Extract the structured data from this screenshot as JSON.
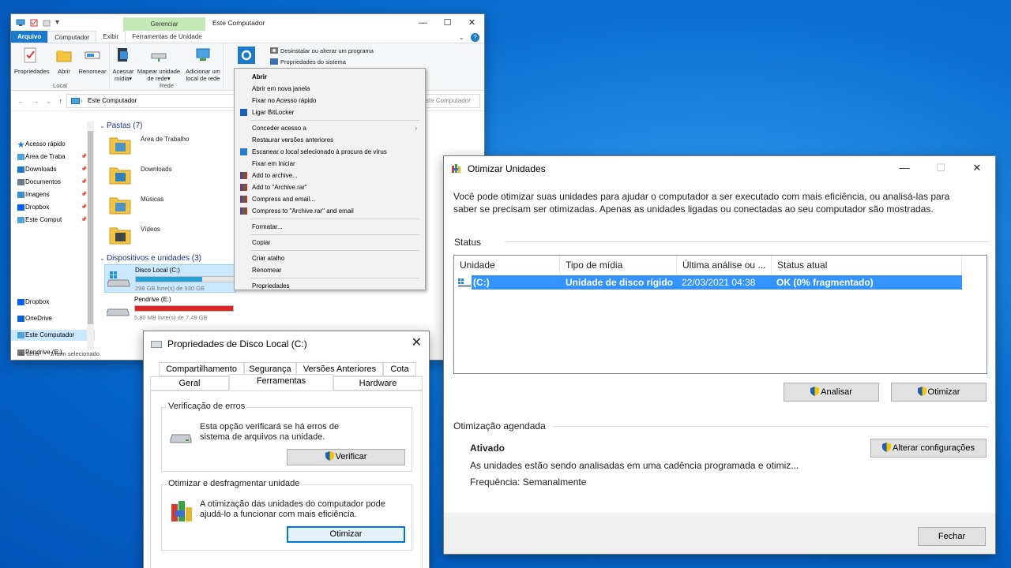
{
  "explorer": {
    "title": "Este Computador",
    "context_tab_header": "Gerenciar",
    "tabs": [
      "Arquivo",
      "Computador",
      "Exibir",
      "Ferramentas de Unidade"
    ],
    "ribbon": {
      "local": {
        "label": "Local",
        "buttons": [
          "Propriedades",
          "Abrir",
          "Renomear"
        ]
      },
      "rede": {
        "label": "Rede",
        "buttons": [
          "Acessar mídia▾",
          "Mapear unidade de rede▾",
          "Adicionar um local de rede"
        ]
      },
      "sistema": {
        "actions": [
          "Desinstalar ou alterar um programa",
          "Propriedades do sistema"
        ]
      }
    },
    "address": "Este Computador",
    "search_placeholder": "ste Computador",
    "nav": [
      {
        "label": "Acesso rápido",
        "icon": "star-icon"
      },
      {
        "label": "Área de Traba",
        "icon": "desktop-folder-icon",
        "pinned": true
      },
      {
        "label": "Downloads",
        "icon": "download-icon",
        "pinned": true
      },
      {
        "label": "Documentos",
        "icon": "documents-icon",
        "pinned": true
      },
      {
        "label": "Imagens",
        "icon": "images-icon",
        "pinned": true
      },
      {
        "label": "Dropbox",
        "icon": "dropbox-icon",
        "pinned": true
      },
      {
        "label": "Este Comput",
        "icon": "computer-icon",
        "pinned": true
      },
      {
        "label": "Dropbox",
        "icon": "dropbox-icon"
      },
      {
        "label": "OneDrive",
        "icon": "onedrive-icon"
      },
      {
        "label": "Este Computador",
        "icon": "computer-icon",
        "selected": true
      },
      {
        "label": "Pendrive (E:)",
        "icon": "usb-drive-icon"
      }
    ],
    "sections": {
      "folders": "Pastas (7)",
      "devices": "Dispositivos e unidades (3)"
    },
    "folders": [
      "Área de Trabalho",
      "Downloads",
      "Músicas",
      "Vídeos"
    ],
    "drives": [
      {
        "name": "Disco Local (C:)",
        "free": "298 GB livre(s) de 930 GB",
        "used_fraction": 0.68,
        "color": "#26a0da",
        "selected": true
      },
      {
        "name": "Pendrive (E:)",
        "free": "5,80 MB livre(s) de 7,49 GB",
        "used_fraction": 0.999,
        "color": "#da2626"
      }
    ],
    "status": {
      "items": "10 itens",
      "selected": "1 item selecionado"
    }
  },
  "context_menu": {
    "items": [
      {
        "label": "Abrir",
        "bold": true
      },
      {
        "label": "Abrir em nova janela"
      },
      {
        "label": "Fixar no Acesso rápido"
      },
      {
        "label": "Ligar BitLocker",
        "icon": "shield-icon"
      },
      {
        "sep": true
      },
      {
        "label": "Conceder acesso a",
        "submenu": true
      },
      {
        "label": "Restaurar versões anteriores"
      },
      {
        "label": "Escanear o local selecionado à procura de vírus",
        "icon": "defender-icon"
      },
      {
        "label": "Fixar em Iniciar"
      },
      {
        "label": "Add to archive...",
        "icon": "winrar-icon"
      },
      {
        "label": "Add to \"Archive.rar\"",
        "icon": "winrar-icon"
      },
      {
        "label": "Compress and email...",
        "icon": "winrar-icon"
      },
      {
        "label": "Compress to \"Archive.rar\" and email",
        "icon": "winrar-icon"
      },
      {
        "sep": true
      },
      {
        "label": "Formatar..."
      },
      {
        "sep": true
      },
      {
        "label": "Copiar"
      },
      {
        "sep": true
      },
      {
        "label": "Criar atalho"
      },
      {
        "label": "Renomear"
      },
      {
        "sep": true
      },
      {
        "label": "Propriedades"
      }
    ]
  },
  "props_dialog": {
    "title": "Propriedades de Disco Local (C:)",
    "tabs_row1": [
      "Compartilhamento",
      "Segurança",
      "Versões Anteriores",
      "Cota"
    ],
    "tabs_row2": [
      "Geral",
      "Ferramentas",
      "Hardware"
    ],
    "active_tab": "Ferramentas",
    "error_check": {
      "title": "Verificação de erros",
      "text1": "Esta opção verificará se há erros de",
      "text2": "sistema de arquivos na unidade.",
      "button": "Verificar"
    },
    "optimize": {
      "title": "Otimizar e desfragmentar unidade",
      "text1": "A otimização das unidades do computador pode",
      "text2": "ajudá-lo a funcionar com mais eficiência.",
      "button": "Otimizar"
    }
  },
  "optimize_window": {
    "title": "Otimizar Unidades",
    "description1": "Você pode otimizar suas unidades para ajudar o computador a ser executado com mais eficiência, ou analisá-las para",
    "description2": "saber se precisam ser otimizadas. Apenas as unidades ligadas ou conectadas ao seu computador são mostradas.",
    "status_label": "Status",
    "columns": [
      "Unidade",
      "Tipo de mídia",
      "Última análise ou ...",
      "Status atual"
    ],
    "rows": [
      {
        "drive": "(C:)",
        "media": "Unidade de disco rígido",
        "last": "22/03/2021 04:38",
        "status": "OK (0% fragmentado)"
      }
    ],
    "analyze_button": "Analisar",
    "optimize_button": "Otimizar",
    "scheduled_label": "Otimização agendada",
    "scheduled_state": "Ativado",
    "scheduled_text": "As unidades estão sendo analisadas em uma cadência programada e otimiz...",
    "frequency": "Frequência: Semanalmente",
    "change_settings_button": "Alterar configurações",
    "close_button": "Fechar"
  },
  "colors": {
    "accent": "#0078d7",
    "selection": "#3393ff",
    "file_tab": "#1979ca",
    "drive_ok": "#26a0da",
    "drive_full": "#da2626"
  }
}
